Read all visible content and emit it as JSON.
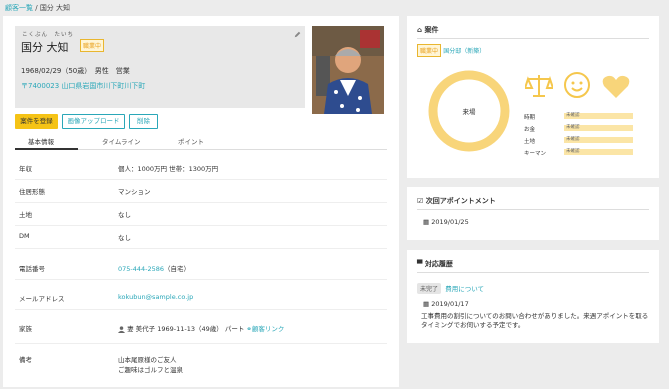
{
  "breadcrumb": {
    "parent": "顧客一覧",
    "sep": " / ",
    "current": "国分 大知"
  },
  "profile": {
    "kana": "こくぶん　たいち",
    "name": "国分 大知",
    "badge": "職業中",
    "birth": "1968/02/29（50歳）　男性　営業",
    "address": "〒7400023 山口県岩国市川下町川下町"
  },
  "actions": {
    "register": "案件を登録",
    "upload": "画像アップロード",
    "delete": "削除"
  },
  "tabs": [
    "基本情報",
    "タイムライン",
    "ポイント"
  ],
  "fields": [
    {
      "label": "年収",
      "value": "個人：1000万円 世帯：1300万円"
    },
    {
      "label": "住居形態",
      "value": "マンション"
    },
    {
      "label": "土地",
      "value": "なし"
    },
    {
      "label": "DM",
      "value": "なし"
    },
    {
      "label": "電話番号",
      "value": "075-444-2586",
      "suffix": "（自宅）"
    },
    {
      "label": "メールアドレス",
      "value": "kokubun@sample.co.jp"
    },
    {
      "label": "家族",
      "value": "妻  美代子  1969-11-13（49歳）  パート",
      "link": "顧客リンク"
    },
    {
      "label": "備考",
      "value": "山本尾原様のご友人",
      "value2": "ご趣味はゴルフと温泉"
    }
  ],
  "case": {
    "title": "案件",
    "status_badge": "職業中",
    "dept": "国分邸（新築）",
    "circle_label": "来場",
    "rows": [
      {
        "label": "時期",
        "value": "未確認"
      },
      {
        "label": "お金",
        "value": "未確認"
      },
      {
        "label": "土地",
        "value": "未確認"
      },
      {
        "label": "キーマン",
        "value": "未確認"
      }
    ],
    "accent": "#f8d57a"
  },
  "next_appt": {
    "title": "次回アポイントメント",
    "date": "2019/01/25"
  },
  "history": {
    "title": "対応履歴",
    "status": "未完了",
    "topic": "費用について",
    "date": "2019/01/17",
    "body": "工事費用の割引についてのお問い合わせがありました。来週アポイントを取るタイミングでお伺いする予定です。"
  }
}
